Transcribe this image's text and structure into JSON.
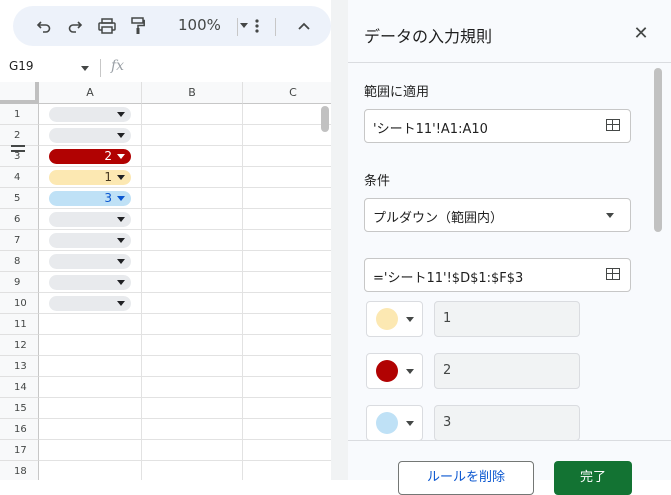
{
  "toolbar": {
    "zoom_label": "100%",
    "icons": [
      "undo-icon",
      "redo-icon",
      "print-icon",
      "paint-format-icon",
      "more-vert-icon",
      "chevron-up-icon"
    ]
  },
  "formula_bar": {
    "name_box": "G19",
    "fx_label": "fx",
    "value": ""
  },
  "sheet": {
    "columns": [
      "A",
      "B",
      "C"
    ],
    "rows": [
      {
        "n": "1",
        "chip": ""
      },
      {
        "n": "2",
        "chip": ""
      },
      {
        "n": "3",
        "chip": "2"
      },
      {
        "n": "4",
        "chip": "1"
      },
      {
        "n": "5",
        "chip": "3"
      },
      {
        "n": "6",
        "chip": ""
      },
      {
        "n": "7",
        "chip": ""
      },
      {
        "n": "8",
        "chip": ""
      },
      {
        "n": "9",
        "chip": ""
      },
      {
        "n": "10",
        "chip": ""
      },
      {
        "n": "11"
      },
      {
        "n": "12"
      },
      {
        "n": "13"
      },
      {
        "n": "14"
      },
      {
        "n": "15"
      },
      {
        "n": "16"
      },
      {
        "n": "17"
      },
      {
        "n": "18"
      }
    ],
    "chip_colors": {
      "1": "#fce8b2",
      "2": "#b10202",
      "3": "#bfe1f6",
      "empty": "#e8eaed"
    }
  },
  "panel": {
    "title": "データの入力規則",
    "apply_range_label": "範囲に適用",
    "apply_range_value": "'シート11'!A1:A10",
    "condition_label": "条件",
    "condition_value": "プルダウン（範囲内）",
    "source_range_value": "='シート11'!$D$1:$F$3",
    "options": [
      {
        "color": "#fce8b2",
        "value": "1"
      },
      {
        "color": "#b10202",
        "value": "2"
      },
      {
        "color": "#bfe1f6",
        "value": "3"
      }
    ],
    "delete_button": "ルールを削除",
    "done_button": "完了"
  }
}
